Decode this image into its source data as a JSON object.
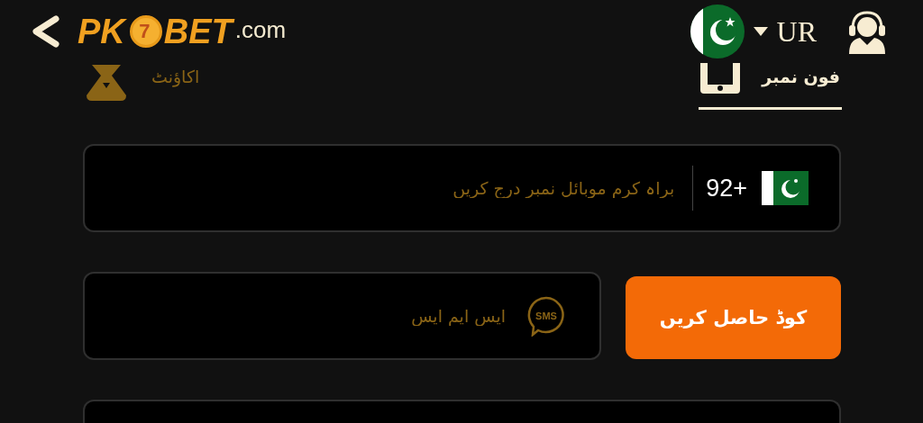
{
  "header": {
    "logo": {
      "prefix": "PK",
      "chip": "7",
      "suffix": "BET",
      "domain": ".com"
    },
    "language": {
      "code": "UR"
    }
  },
  "tabs": [
    {
      "label": "فون نمبر",
      "selected": true,
      "kind": "phone"
    },
    {
      "label": "اکاؤنٹ",
      "selected": false,
      "kind": "account"
    }
  ],
  "phone_field": {
    "country_code": "92+",
    "placeholder": "براہ کرم موبائل نمبر درج کریں"
  },
  "sms_field": {
    "placeholder": "ایس ایم ایس",
    "icon_label": "SMS"
  },
  "get_code_button": {
    "label": "کوڈ حاصل کریں"
  }
}
